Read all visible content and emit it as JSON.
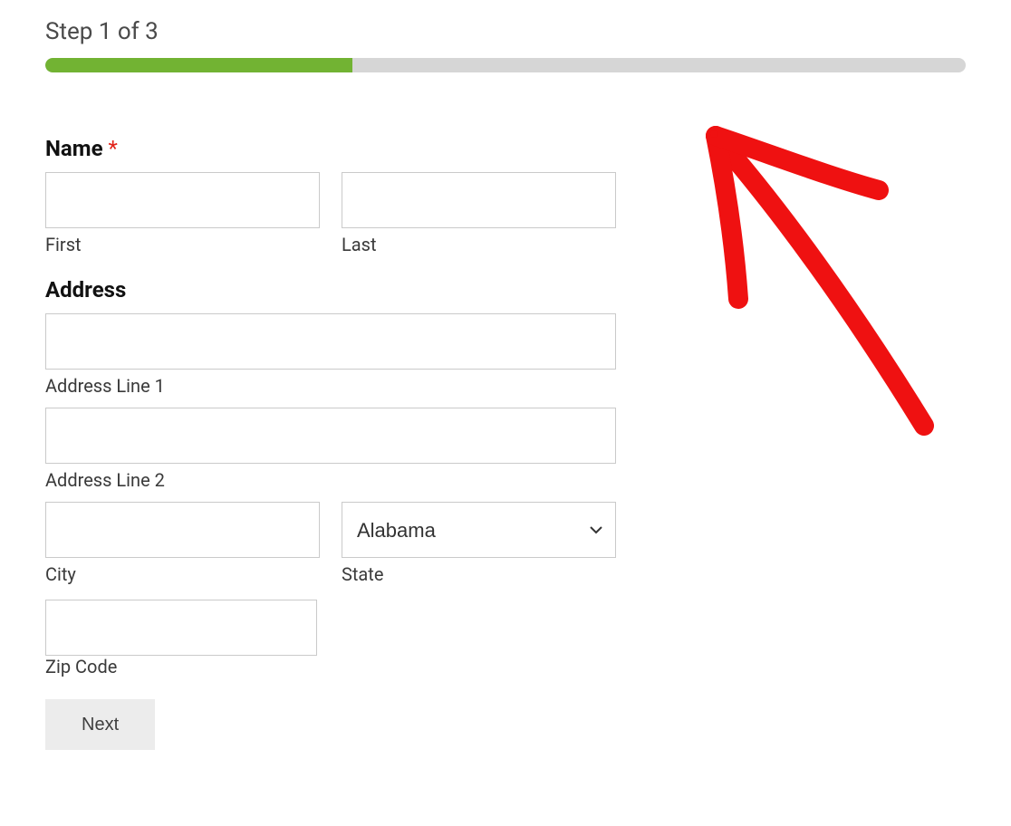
{
  "progress": {
    "step_text": "Step 1 of 3",
    "percent": 33.34
  },
  "form": {
    "name_section": {
      "legend": "Name",
      "required": true,
      "required_mark": "*",
      "first": {
        "sublabel": "First",
        "value": ""
      },
      "last": {
        "sublabel": "Last",
        "value": ""
      }
    },
    "address_section": {
      "legend": "Address",
      "line1": {
        "sublabel": "Address Line 1",
        "value": ""
      },
      "line2": {
        "sublabel": "Address Line 2",
        "value": ""
      },
      "city": {
        "sublabel": "City",
        "value": ""
      },
      "state": {
        "sublabel": "State",
        "selected": "Alabama"
      },
      "zip": {
        "sublabel": "Zip Code",
        "value": ""
      }
    },
    "buttons": {
      "next": "Next"
    }
  },
  "colors": {
    "progress_fill": "#72b333",
    "progress_bg": "#d6d6d6",
    "required": "#e2231a"
  }
}
